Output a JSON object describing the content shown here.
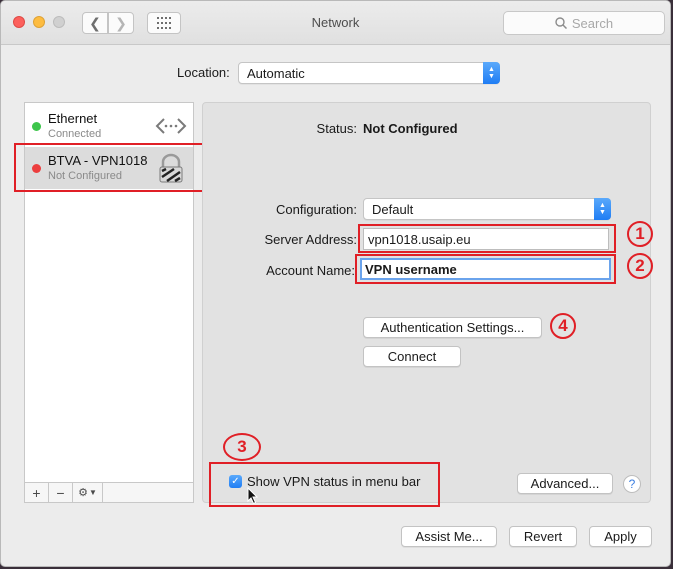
{
  "window": {
    "title": "Network",
    "search_placeholder": "Search"
  },
  "location": {
    "label": "Location:",
    "value": "Automatic"
  },
  "services": [
    {
      "name": "Ethernet",
      "status": "Connected",
      "status_color": "#3dc54b",
      "icon": "ethernet-arrows-icon"
    },
    {
      "name": "BTVA - VPN1018",
      "status": "Not Configured",
      "status_color": "#ec3e3e",
      "icon": "vpn-lock-icon"
    }
  ],
  "sidebar_tools": {
    "add": "+",
    "remove": "−",
    "action": "gear-icon"
  },
  "details": {
    "status_label": "Status:",
    "status_value": "Not Configured",
    "configuration_label": "Configuration:",
    "configuration_value": "Default",
    "server_address_label": "Server Address:",
    "server_address_value": "vpn1018.usaip.eu",
    "account_name_label": "Account Name:",
    "account_name_value": "VPN username",
    "auth_settings_label": "Authentication Settings...",
    "connect_label": "Connect",
    "show_status_label": "Show VPN status in menu bar",
    "show_status_checked": true,
    "advanced_label": "Advanced...",
    "help_label": "?"
  },
  "footer": {
    "assist_label": "Assist Me...",
    "revert_label": "Revert",
    "apply_label": "Apply"
  },
  "annotations": [
    "1",
    "2",
    "3",
    "4"
  ],
  "colors": {
    "annotation_red": "#e01f26",
    "accent_blue": "#1f7df4"
  }
}
